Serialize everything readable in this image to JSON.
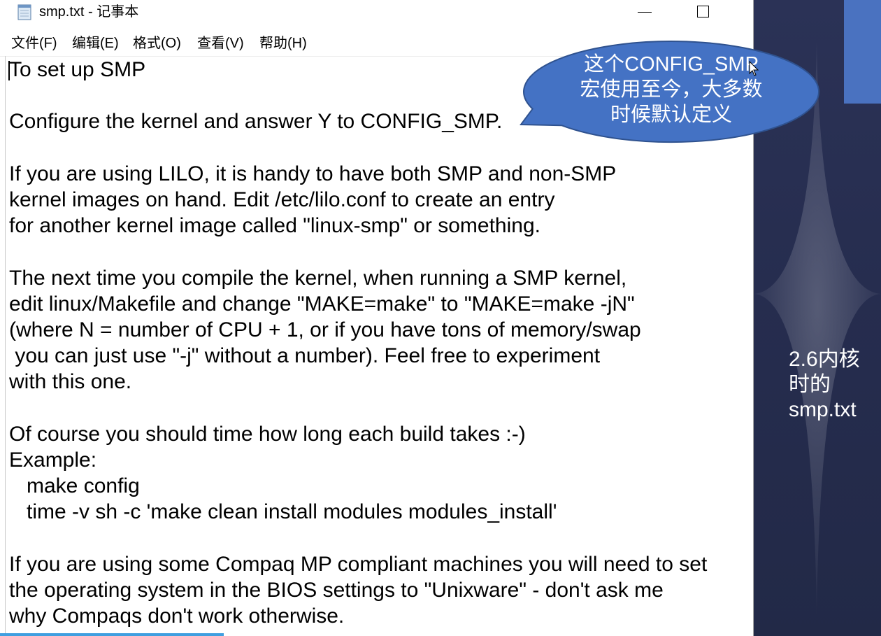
{
  "window": {
    "title": "smp.txt - 记事本",
    "app_icon": "notepad-icon",
    "controls": [
      "minimize-icon",
      "maximize-icon"
    ]
  },
  "menu": {
    "items": [
      {
        "label": "文件(F)"
      },
      {
        "label": "编辑(E)"
      },
      {
        "label": "格式(O)"
      },
      {
        "label": "查看(V)"
      },
      {
        "label": "帮助(H)"
      }
    ]
  },
  "editor": {
    "lines": [
      "To set up SMP",
      "",
      "Configure the kernel and answer Y to CONFIG_SMP.",
      "",
      "If you are using LILO, it is handy to have both SMP and non-SMP",
      "kernel images on hand. Edit /etc/lilo.conf to create an entry",
      "for another kernel image called \"linux-smp\" or something.",
      "",
      "The next time you compile the kernel, when running a SMP kernel,",
      "edit linux/Makefile and change \"MAKE=make\" to \"MAKE=make -jN\"",
      "(where N = number of CPU + 1, or if you have tons of memory/swap",
      " you can just use \"-j\" without a number). Feel free to experiment",
      "with this one.",
      "",
      "Of course you should time how long each build takes :-)",
      "Example:",
      "   make config",
      "   time -v sh -c 'make clean install modules modules_install'",
      "",
      "If you are using some Compaq MP compliant machines you will need to set",
      "the operating system in the BIOS settings to \"Unixware\" - don't ask me",
      "why Compaqs don't work otherwise."
    ]
  },
  "callout": {
    "lines": [
      "这个CONFIG_SMP",
      "宏使用至今，大多数",
      "时候默认定义"
    ]
  },
  "slide_note": {
    "lines": [
      "2.6内核",
      "时的",
      "smp.txt"
    ]
  },
  "overlay": {
    "pointer_icon": "mouse-pointer-icon"
  },
  "colors": {
    "callout_fill": "#4472c4",
    "callout_border": "#2f528f",
    "slide_background": "#262d4f",
    "slide_accent": "#4a72c0",
    "progress_bar": "#3f9fe0"
  }
}
